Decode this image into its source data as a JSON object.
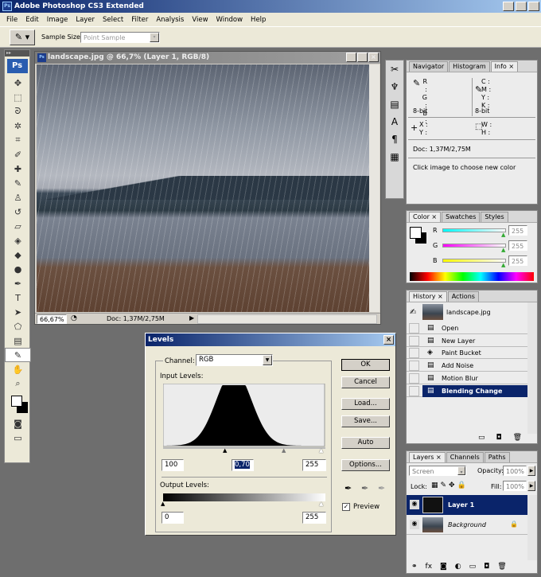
{
  "app": {
    "title": "Adobe Photoshop CS3 Extended",
    "logo": "Ps"
  },
  "menu": [
    "File",
    "Edit",
    "Image",
    "Layer",
    "Select",
    "Filter",
    "Analysis",
    "View",
    "Window",
    "Help"
  ],
  "options": {
    "sample_size_label": "Sample Size:",
    "sample_size_value": "Point Sample"
  },
  "toolbox": {
    "logo": "Ps",
    "tools": [
      "move-icon",
      "marquee-icon",
      "lasso-icon",
      "magic-wand-icon",
      "crop-icon",
      "slice-icon",
      "healing-brush-icon",
      "brush-icon",
      "clone-stamp-icon",
      "history-brush-icon",
      "eraser-icon",
      "paint-bucket-icon",
      "blur-icon",
      "dodge-icon",
      "pen-icon",
      "type-icon",
      "path-selection-icon",
      "shape-icon",
      "notes-icon",
      "eyedropper-icon",
      "hand-icon",
      "zoom-icon"
    ]
  },
  "document": {
    "title": "landscape.jpg @ 66,7% (Layer 1, RGB/8)",
    "zoom": "66,67%",
    "doc_size": "Doc: 1,37M/2,75M"
  },
  "levels": {
    "title": "Levels",
    "channel_label": "Channel:",
    "channel_value": "RGB",
    "input_label": "Input Levels:",
    "input_black": "100",
    "input_gamma": "0,70",
    "input_white": "255",
    "output_label": "Output Levels:",
    "output_black": "0",
    "output_white": "255",
    "buttons": [
      "OK",
      "Cancel",
      "Load...",
      "Save...",
      "Auto",
      "Options..."
    ],
    "preview_label": "Preview",
    "preview_checked": true
  },
  "info": {
    "tabs": [
      "Navigator",
      "Histogram",
      "Info"
    ],
    "rgb": [
      "R :",
      "G :",
      "B :"
    ],
    "cmyk": [
      "C :",
      "M :",
      "Y :",
      "K :"
    ],
    "bit_left": "8-bit",
    "bit_right": "8-bit",
    "xy": [
      "X :",
      "Y :"
    ],
    "wh": [
      "W :",
      "H :"
    ],
    "doc": "Doc: 1,37M/2,75M",
    "hint": "Click image to choose new color"
  },
  "color": {
    "tabs": [
      "Color",
      "Swatches",
      "Styles"
    ],
    "channels": [
      {
        "label": "R",
        "value": "255"
      },
      {
        "label": "G",
        "value": "255"
      },
      {
        "label": "B",
        "value": "255"
      }
    ]
  },
  "history": {
    "tabs": [
      "History",
      "Actions"
    ],
    "snapshot": "landscape.jpg",
    "items": [
      "Open",
      "New Layer",
      "Paint Bucket",
      "Add Noise",
      "Motion Blur",
      "Blending Change"
    ],
    "active_index": 5
  },
  "layers": {
    "tabs": [
      "Layers",
      "Channels",
      "Paths"
    ],
    "blend_mode": "Screen",
    "opacity_label": "Opacity:",
    "opacity": "100%",
    "lock_label": "Lock:",
    "fill_label": "Fill:",
    "fill": "100%",
    "items": [
      {
        "name": "Layer 1",
        "selected": true
      },
      {
        "name": "Background",
        "locked": true
      }
    ]
  }
}
